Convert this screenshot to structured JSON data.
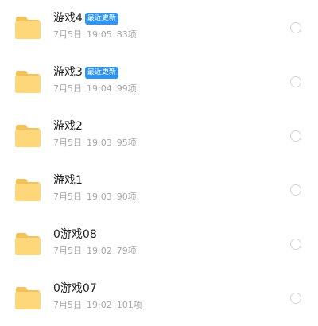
{
  "colors": {
    "badge": "#2f95f3",
    "folder_body": "#fdd77a",
    "folder_tab": "#f3c35a"
  },
  "icons": {
    "folder": "folder-icon",
    "select": "radio-circle-icon"
  },
  "folders": [
    {
      "name": "游戏4",
      "badge": "最近更新",
      "date": "7月5日",
      "time": "19:05",
      "count": "83项"
    },
    {
      "name": "游戏3",
      "badge": "最近更新",
      "date": "7月5日",
      "time": "19:04",
      "count": "99项"
    },
    {
      "name": "游戏2",
      "badge": "",
      "date": "7月5日",
      "time": "19:03",
      "count": "95项"
    },
    {
      "name": "游戏1",
      "badge": "",
      "date": "7月5日",
      "time": "19:03",
      "count": "90项"
    },
    {
      "name": "0游戏08",
      "badge": "",
      "date": "7月5日",
      "time": "19:02",
      "count": "79项"
    },
    {
      "name": "0游戏07",
      "badge": "",
      "date": "7月5日",
      "time": "19:02",
      "count": "101项"
    }
  ]
}
